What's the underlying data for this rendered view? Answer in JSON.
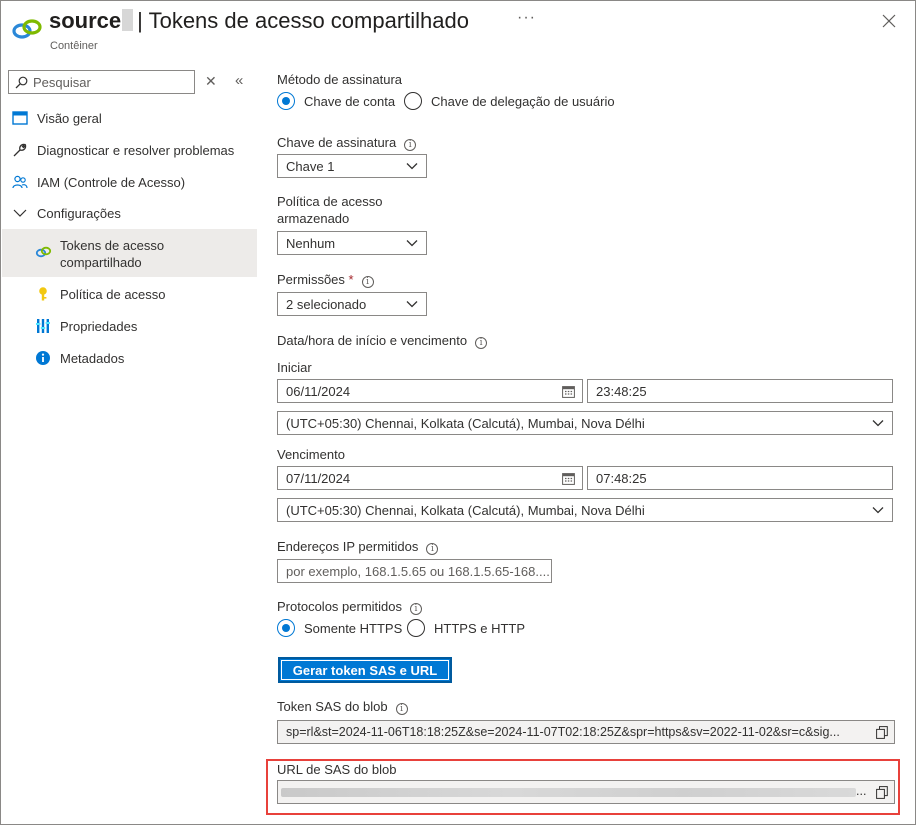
{
  "header": {
    "resource_name": "source",
    "title": "| Tokens de acesso compartilhado",
    "subtitle": "Contêiner",
    "more_label": "···"
  },
  "sidebar": {
    "search_placeholder": "Pesquisar",
    "items": [
      {
        "label": "Visão geral",
        "icon": "overview-icon"
      },
      {
        "label": "Diagnosticar e resolver problemas",
        "icon": "wrench-icon"
      },
      {
        "label": "IAM (Controle de Acesso)",
        "icon": "people-icon"
      },
      {
        "label": "Configurações",
        "icon": "chevron-down-icon"
      },
      {
        "label": "Tokens de acesso compartilhado",
        "icon": "link-icon",
        "selected": true
      },
      {
        "label": "Política de acesso",
        "icon": "key-icon"
      },
      {
        "label": "Propriedades",
        "icon": "properties-icon"
      },
      {
        "label": "Metadados",
        "icon": "info-icon"
      }
    ]
  },
  "form": {
    "signing_method": {
      "label": "Método de assinatura",
      "options": [
        "Chave de conta",
        "Chave de delegação de usuário"
      ],
      "selected": "Chave de conta"
    },
    "signing_key": {
      "label": "Chave de assinatura",
      "value": "Chave 1"
    },
    "stored_policy": {
      "label_line1": "Política de acesso",
      "label_line2": "armazenado",
      "value": "Nenhum"
    },
    "permissions": {
      "label": "Permissões",
      "required_mark": "*",
      "value": "2 selecionado"
    },
    "datetime": {
      "label": "Data/hora de início e vencimento",
      "start_label": "Iniciar",
      "start_date": "06/11/2024",
      "start_time": "23:48:25",
      "start_tz": "(UTC+05:30) Chennai, Kolkata (Calcutá), Mumbai, Nova Délhi",
      "expiry_label": "Vencimento",
      "expiry_date": "07/11/2024",
      "expiry_time": "07:48:25",
      "expiry_tz": "(UTC+05:30) Chennai, Kolkata (Calcutá), Mumbai, Nova Délhi"
    },
    "ip": {
      "label": "Endereços IP permitidos",
      "placeholder": "por exemplo, 168.1.5.65 ou 168.1.5.65-168...."
    },
    "protocols": {
      "label": "Protocolos permitidos",
      "options": [
        "Somente HTTPS",
        "HTTPS e HTTP"
      ],
      "selected": "Somente HTTPS"
    },
    "generate_button": "Gerar token SAS e URL",
    "blob_sas_token": {
      "label": "Token SAS do blob",
      "value": "sp=rl&st=2024-11-06T18:18:25Z&se=2024-11-07T02:18:25Z&spr=https&sv=2022-11-02&sr=c&sig..."
    },
    "blob_sas_url": {
      "label": "URL de SAS do blob",
      "value_ellipsis": "..."
    }
  },
  "colors": {
    "accent": "#0078d4",
    "highlight_border": "#e8413b",
    "selected_bg": "#edebe9"
  }
}
